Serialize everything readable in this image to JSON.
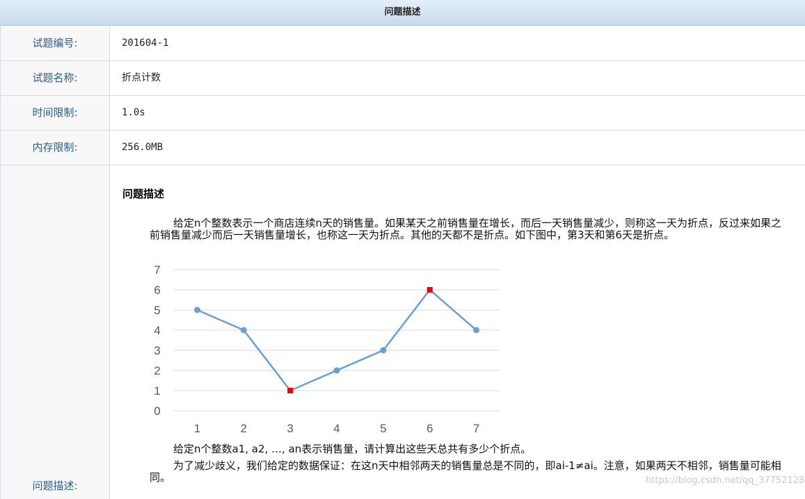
{
  "header": {
    "title": "问题描述"
  },
  "info_rows": [
    {
      "label": "试题编号:",
      "value": "201604-1"
    },
    {
      "label": "试题名称:",
      "value": "折点计数"
    },
    {
      "label": "时间限制:",
      "value": "1.0s"
    },
    {
      "label": "内存限制:",
      "value": "256.0MB"
    }
  ],
  "description": {
    "label": "问题描述:",
    "section_title": "问题描述",
    "para1": "给定n个整数表示一个商店连续n天的销售量。如果某天之前销售量在增长，而后一天销售量减少，则称这一天为折点，反过来如果之前销售量减少而后一天销售量增长，也称这一天为折点。其他的天都不是折点。如下图中，第3天和第6天是折点。",
    "para2": "给定n个整数a1, a2, …, an表示销售量，请计算出这些天总共有多少个折点。",
    "para3": "为了减少歧义，我们给定的数据保证：在这n天中相邻两天的销售量总是不同的，即ai-1≠ai。注意，如果两天不相邻，销售量可能相同。"
  },
  "watermark": "https://blog.csdn.net/qq_37752128",
  "chart_data": {
    "type": "line",
    "x": [
      1,
      2,
      3,
      4,
      5,
      6,
      7
    ],
    "values": [
      5,
      4,
      1,
      2,
      3,
      6,
      4
    ],
    "ylim": [
      0,
      7
    ],
    "yticks": [
      0,
      1,
      2,
      3,
      4,
      5,
      6,
      7
    ],
    "highlight_points": [
      3,
      6
    ],
    "line_color": "#6a9fd4",
    "highlight_color": "#e8000b",
    "grid": true
  }
}
